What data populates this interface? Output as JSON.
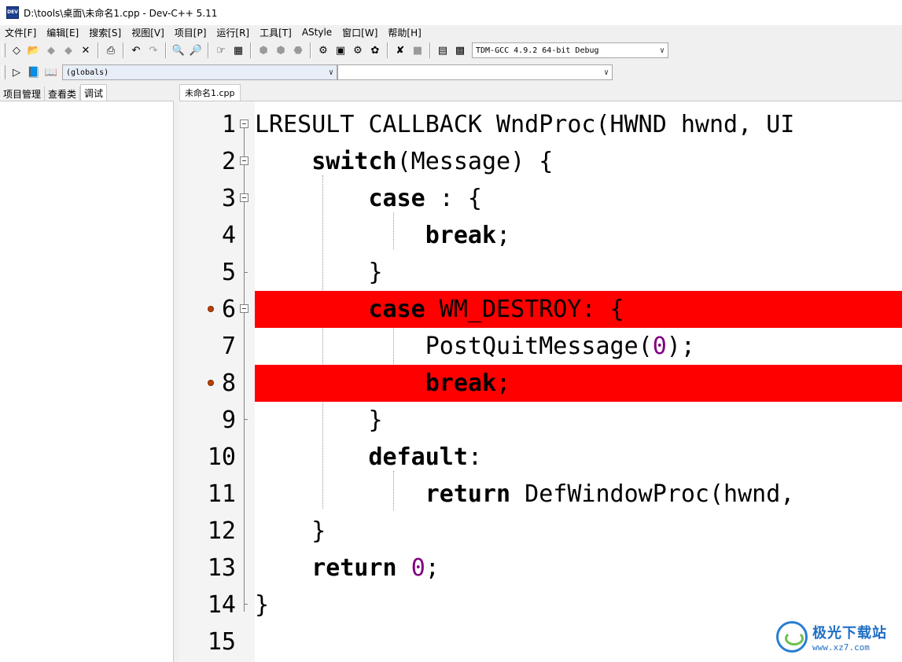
{
  "window": {
    "title": "D:\\tools\\桌面\\未命名1.cpp - Dev-C++ 5.11",
    "icon_text": "DEV"
  },
  "menu": [
    "文件[F]",
    "编辑[E]",
    "搜索[S]",
    "视图[V]",
    "项目[P]",
    "运行[R]",
    "工具[T]",
    "AStyle",
    "窗口[W]",
    "帮助[H]"
  ],
  "toolbar": {
    "compiler_select": "TDM-GCC 4.9.2 64-bit Debug",
    "scope_select": "(globals)",
    "member_select": ""
  },
  "left_tabs": [
    "项目管理",
    "查看类",
    "调试"
  ],
  "editor": {
    "tab": "未命名1.cpp",
    "breakpoint_color": "#ff0000",
    "lines": [
      {
        "n": "1",
        "text": "LRESULT CALLBACK WndProc(HWND hwnd, UI"
      },
      {
        "n": "2",
        "text": "    switch(Message) {"
      },
      {
        "n": "3",
        "text": "        case : {"
      },
      {
        "n": "4",
        "text": "            break;"
      },
      {
        "n": "5",
        "text": "        }"
      },
      {
        "n": "6",
        "text": "        case WM_DESTROY: {",
        "breakpoint": true
      },
      {
        "n": "7",
        "text": "            PostQuitMessage(0);"
      },
      {
        "n": "8",
        "text": "            break;",
        "breakpoint": true
      },
      {
        "n": "9",
        "text": "        }"
      },
      {
        "n": "10",
        "text": "        default:"
      },
      {
        "n": "11",
        "text": "            return DefWindowProc(hwnd,"
      },
      {
        "n": "12",
        "text": "    }"
      },
      {
        "n": "13",
        "text": "    return 0;"
      },
      {
        "n": "14",
        "text": "}"
      },
      {
        "n": "15",
        "text": ""
      }
    ]
  },
  "watermark": {
    "title": "极光下载站",
    "url": "www.xz7.com"
  }
}
